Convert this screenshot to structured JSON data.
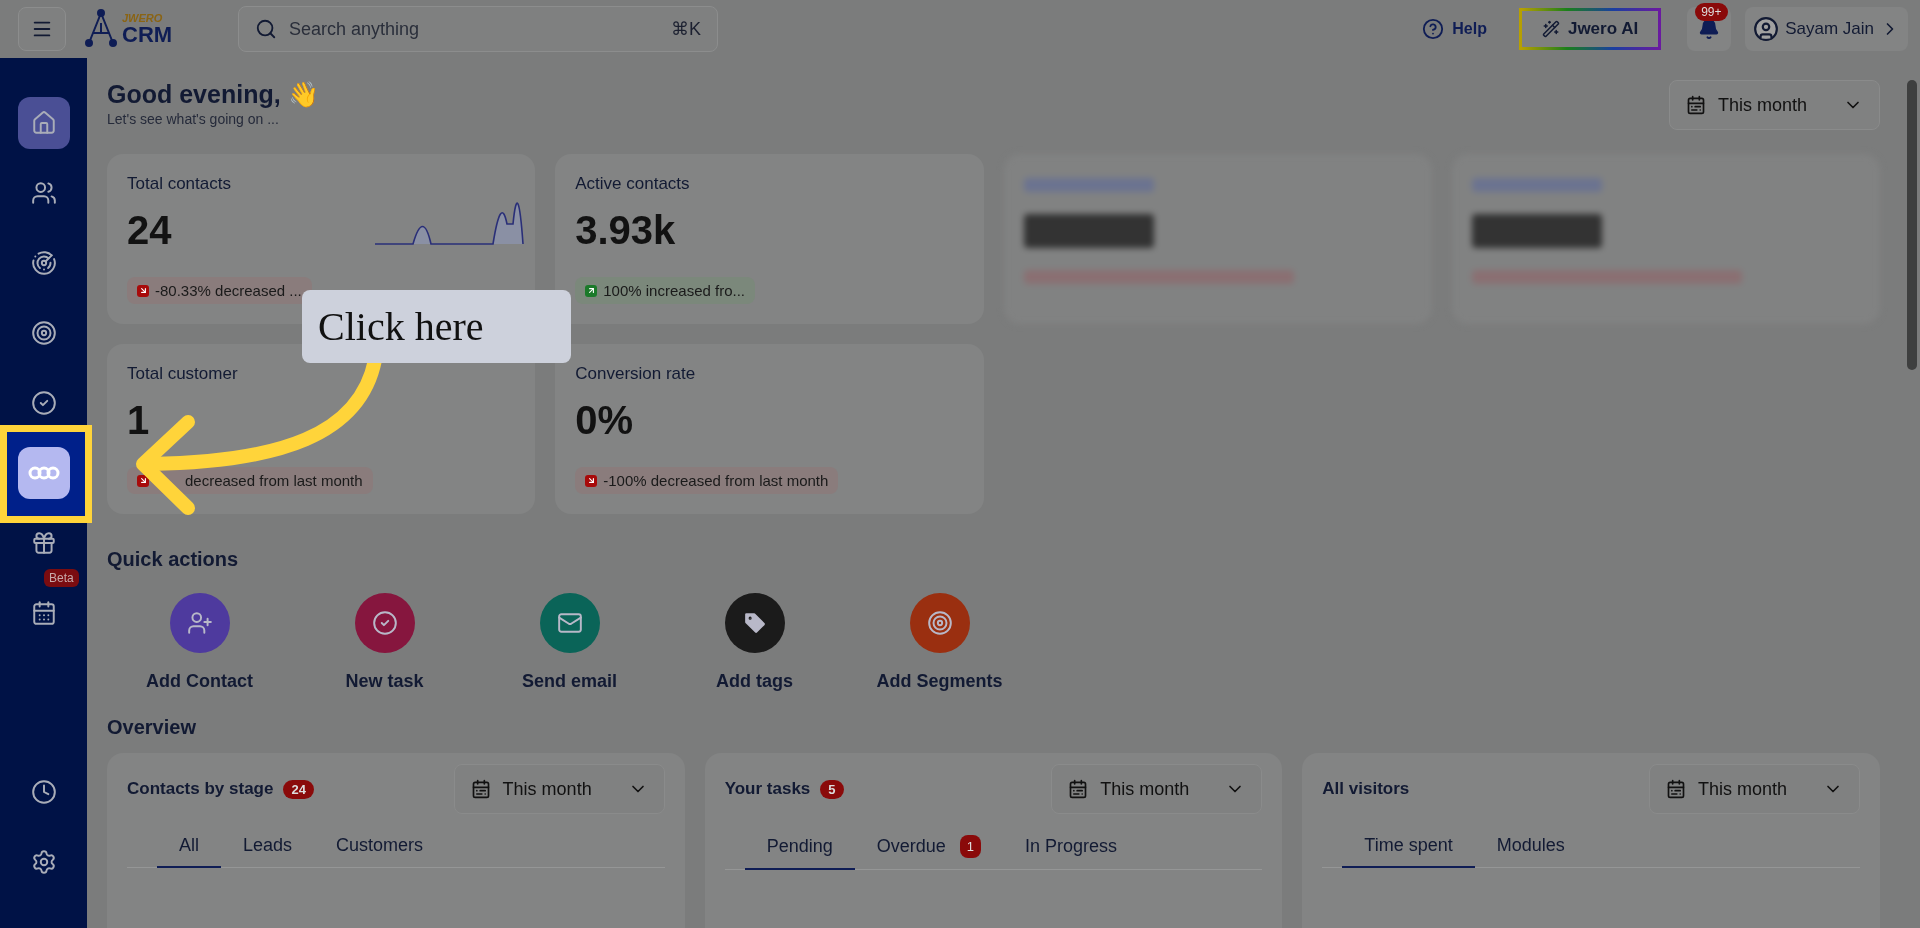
{
  "topbar": {
    "logo": {
      "top": "JWERO",
      "bottom": "CRM"
    },
    "search": {
      "placeholder": "Search anything",
      "shortcut": "⌘K"
    },
    "help": "Help",
    "ai_button": "Jwero AI",
    "notifications_badge": "99+",
    "user": "Sayam Jain"
  },
  "sidebar": {
    "items": [
      {
        "selected": true,
        "spotlight": false
      },
      {
        "selected": false,
        "spotlight": false
      },
      {
        "selected": false,
        "spotlight": false
      },
      {
        "selected": false,
        "spotlight": false
      },
      {
        "selected": false,
        "spotlight": false
      },
      {
        "selected": false,
        "spotlight": true
      },
      {
        "selected": false,
        "spotlight": false
      },
      {
        "selected": false,
        "spotlight": false,
        "badge": "Beta"
      }
    ],
    "bottom_items": [
      {
        "selected": false,
        "spotlight": false
      },
      {
        "selected": false,
        "spotlight": false
      }
    ]
  },
  "greeting": {
    "title": "Good evening, 👋",
    "subtitle": "Let's see what's going on ..."
  },
  "period": "This month",
  "stats": [
    {
      "kind": "stat",
      "label": "Total contacts",
      "value": "24",
      "change": "-80.33% decreased ...",
      "increased": false,
      "sparkline": true
    },
    {
      "kind": "stat",
      "label": "Active contacts",
      "value": "3.93k",
      "change": "100% increased fro...",
      "increased": true,
      "sparkline": false
    },
    {
      "kind": "blurred"
    },
    {
      "kind": "blurred"
    },
    {
      "kind": "stat",
      "label": "Total customer",
      "value": "1",
      "change": "decreased from last month",
      "increased": false,
      "sparkline": false
    },
    {
      "kind": "stat",
      "label": "Conversion rate",
      "value": "0%",
      "change": "-100% decreased from last month",
      "increased": false,
      "sparkline": false
    }
  ],
  "quick_actions": {
    "title": "Quick actions",
    "items": [
      {
        "label": "Add Contact",
        "color": "#4e3a9e"
      },
      {
        "label": "New task",
        "color": "#86163e"
      },
      {
        "label": "Send email",
        "color": "#0a6458"
      },
      {
        "label": "Add tags",
        "color": "#1b1b1b"
      },
      {
        "label": "Add Segments",
        "color": "#9a2f10"
      }
    ]
  },
  "overview": {
    "title": "Overview",
    "panels": [
      {
        "title": "Contacts by stage",
        "badge": "24",
        "period": "This month",
        "tabs": [
          {
            "label": "All",
            "selected": true
          },
          {
            "label": "Leads",
            "selected": false
          },
          {
            "label": "Customers",
            "selected": false
          }
        ]
      },
      {
        "title": "Your tasks",
        "badge": "5",
        "period": "This month",
        "tabs": [
          {
            "label": "Pending",
            "selected": true
          },
          {
            "label": "Overdue",
            "selected": false,
            "badge": "1"
          },
          {
            "label": "In Progress",
            "selected": false
          }
        ]
      },
      {
        "title": "All visitors",
        "period": "This month",
        "tabs": [
          {
            "label": "Time spent",
            "selected": true
          },
          {
            "label": "Modules",
            "selected": false
          }
        ]
      }
    ]
  },
  "tutorial": {
    "callout": "Click here"
  }
}
